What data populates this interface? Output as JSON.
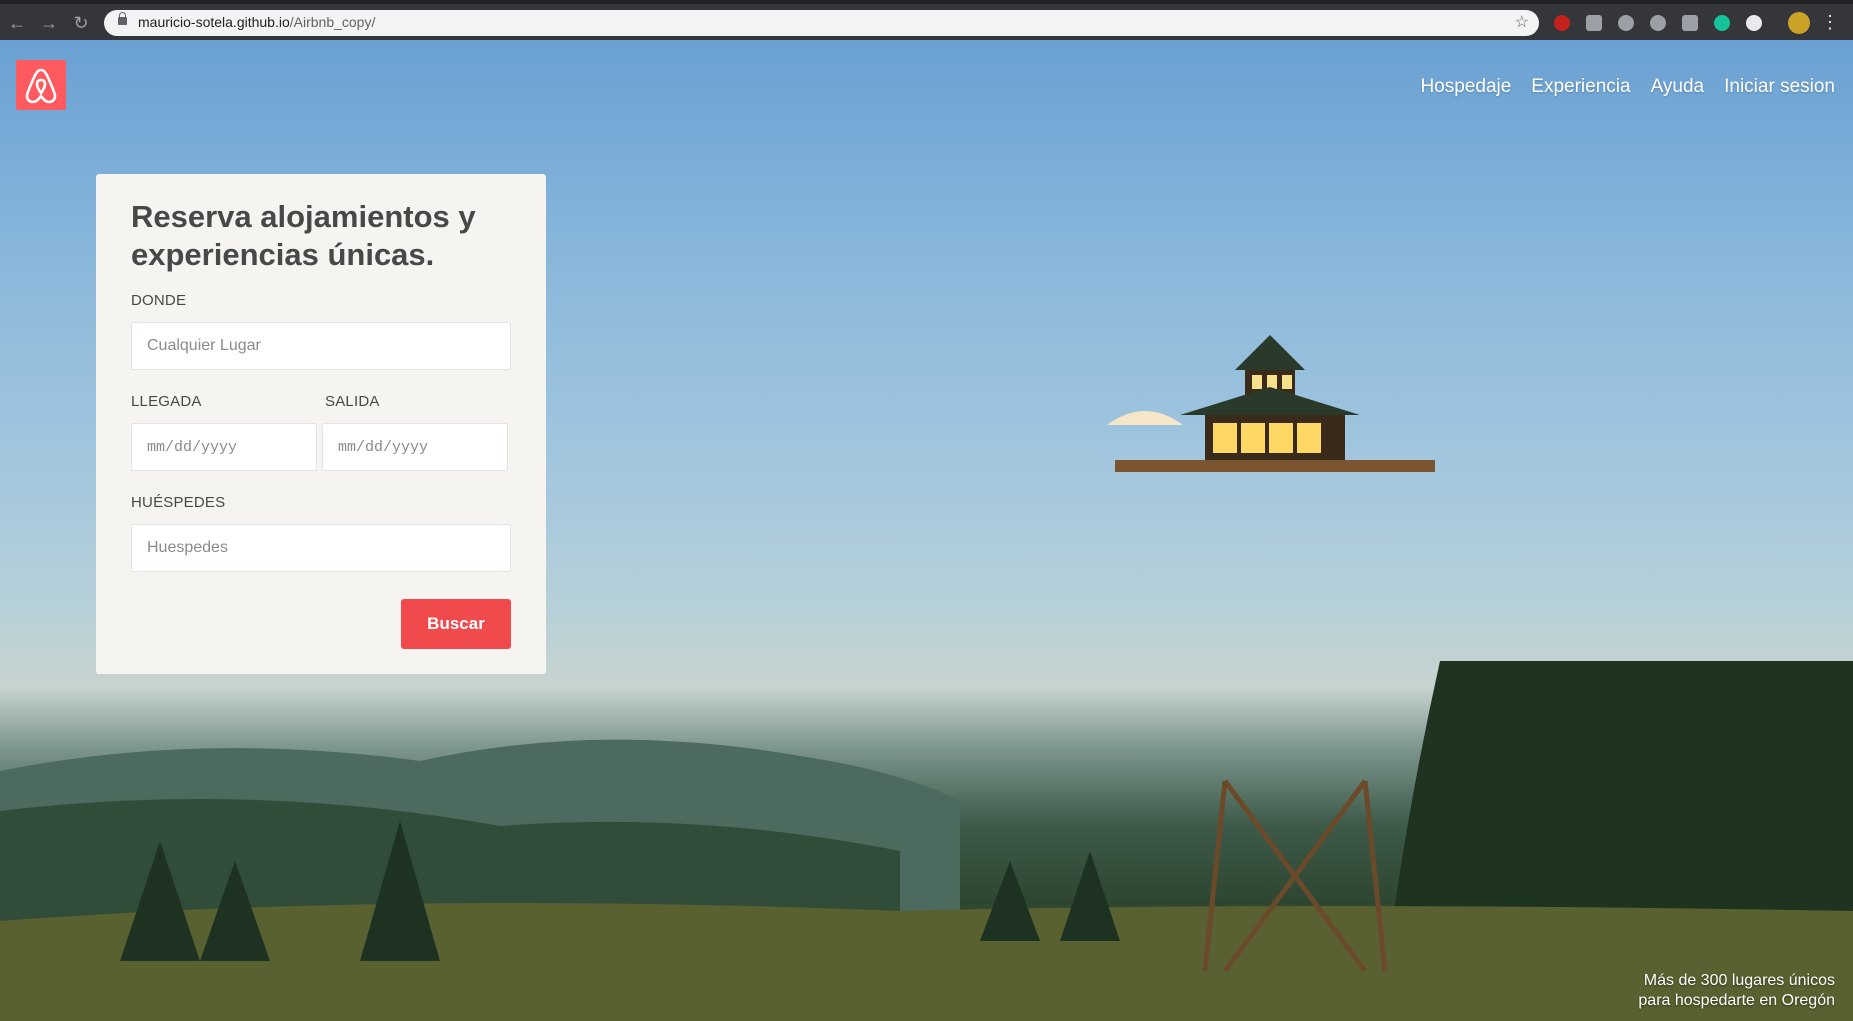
{
  "browser": {
    "url_host": "mauricio-sotela.github.io",
    "url_path": "/Airbnb_copy/",
    "extensions": [
      "#c5221f",
      "#9aa0a6",
      "#9aa0a6",
      "#9aa0a6",
      "#9aa0a6",
      "#15c39a",
      "#e8eaed",
      "#c9a227"
    ]
  },
  "header": {
    "nav": [
      "Hospedaje",
      "Experiencia",
      "Ayuda",
      "Iniciar sesion"
    ]
  },
  "search_card": {
    "title": "Reserva alojamientos y experiencias únicas.",
    "where_label": "DONDE",
    "where_placeholder": "Cualquier Lugar",
    "checkin_label": "LLEGADA",
    "checkin_placeholder": "mm/dd/yyyy",
    "checkout_label": "SALIDA",
    "checkout_placeholder": "mm/dd/yyyy",
    "guests_label": "HUÉSPEDES",
    "guests_placeholder": "Huespedes",
    "search_button": "Buscar"
  },
  "caption": {
    "line1": "Más de 300 lugares únicos",
    "line2": "para hospedarte en Oregón"
  },
  "colors": {
    "brand": "#ff5a5f",
    "button": "#f04a4d"
  }
}
